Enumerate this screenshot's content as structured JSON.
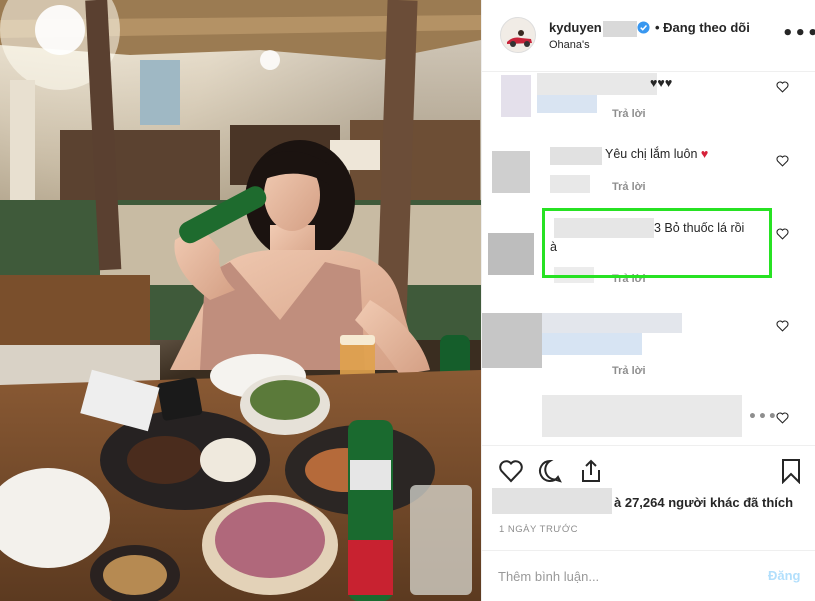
{
  "post": {
    "photo_alt": "",
    "header": {
      "username": "kyduyen",
      "follow_label": "• Đang theo dõi",
      "location": "Ohana's",
      "more_label": "•••"
    },
    "comments": [
      {
        "text": "♥♥♥",
        "reply_label": "Trả lời"
      },
      {
        "text": "Yêu chị lắm luôn",
        "emoji": "♥",
        "reply_label": "Trả lời"
      },
      {
        "text_line1": "3 Bỏ thuốc lá rồi",
        "text_line2": "à",
        "reply_label": "Trả lời"
      },
      {
        "text": "",
        "reply_label": "Trả lời"
      },
      {
        "text": "",
        "more_label": "•••"
      }
    ],
    "likes_text": "à 27,264 người khác đã thích",
    "time_label": "1 NGÀY TRƯỚC",
    "add_comment": {
      "placeholder": "Thêm bình luận...",
      "post_label": "Đăng"
    },
    "colors": {
      "highlight": "#27e223",
      "heart_red": "#d6213a",
      "verified_blue": "#3897f0",
      "post_disabled": "#b2dffc"
    },
    "icons": [
      "heart-icon",
      "comment-icon",
      "share-icon",
      "bookmark-icon",
      "verified-icon",
      "more-icon"
    ]
  }
}
